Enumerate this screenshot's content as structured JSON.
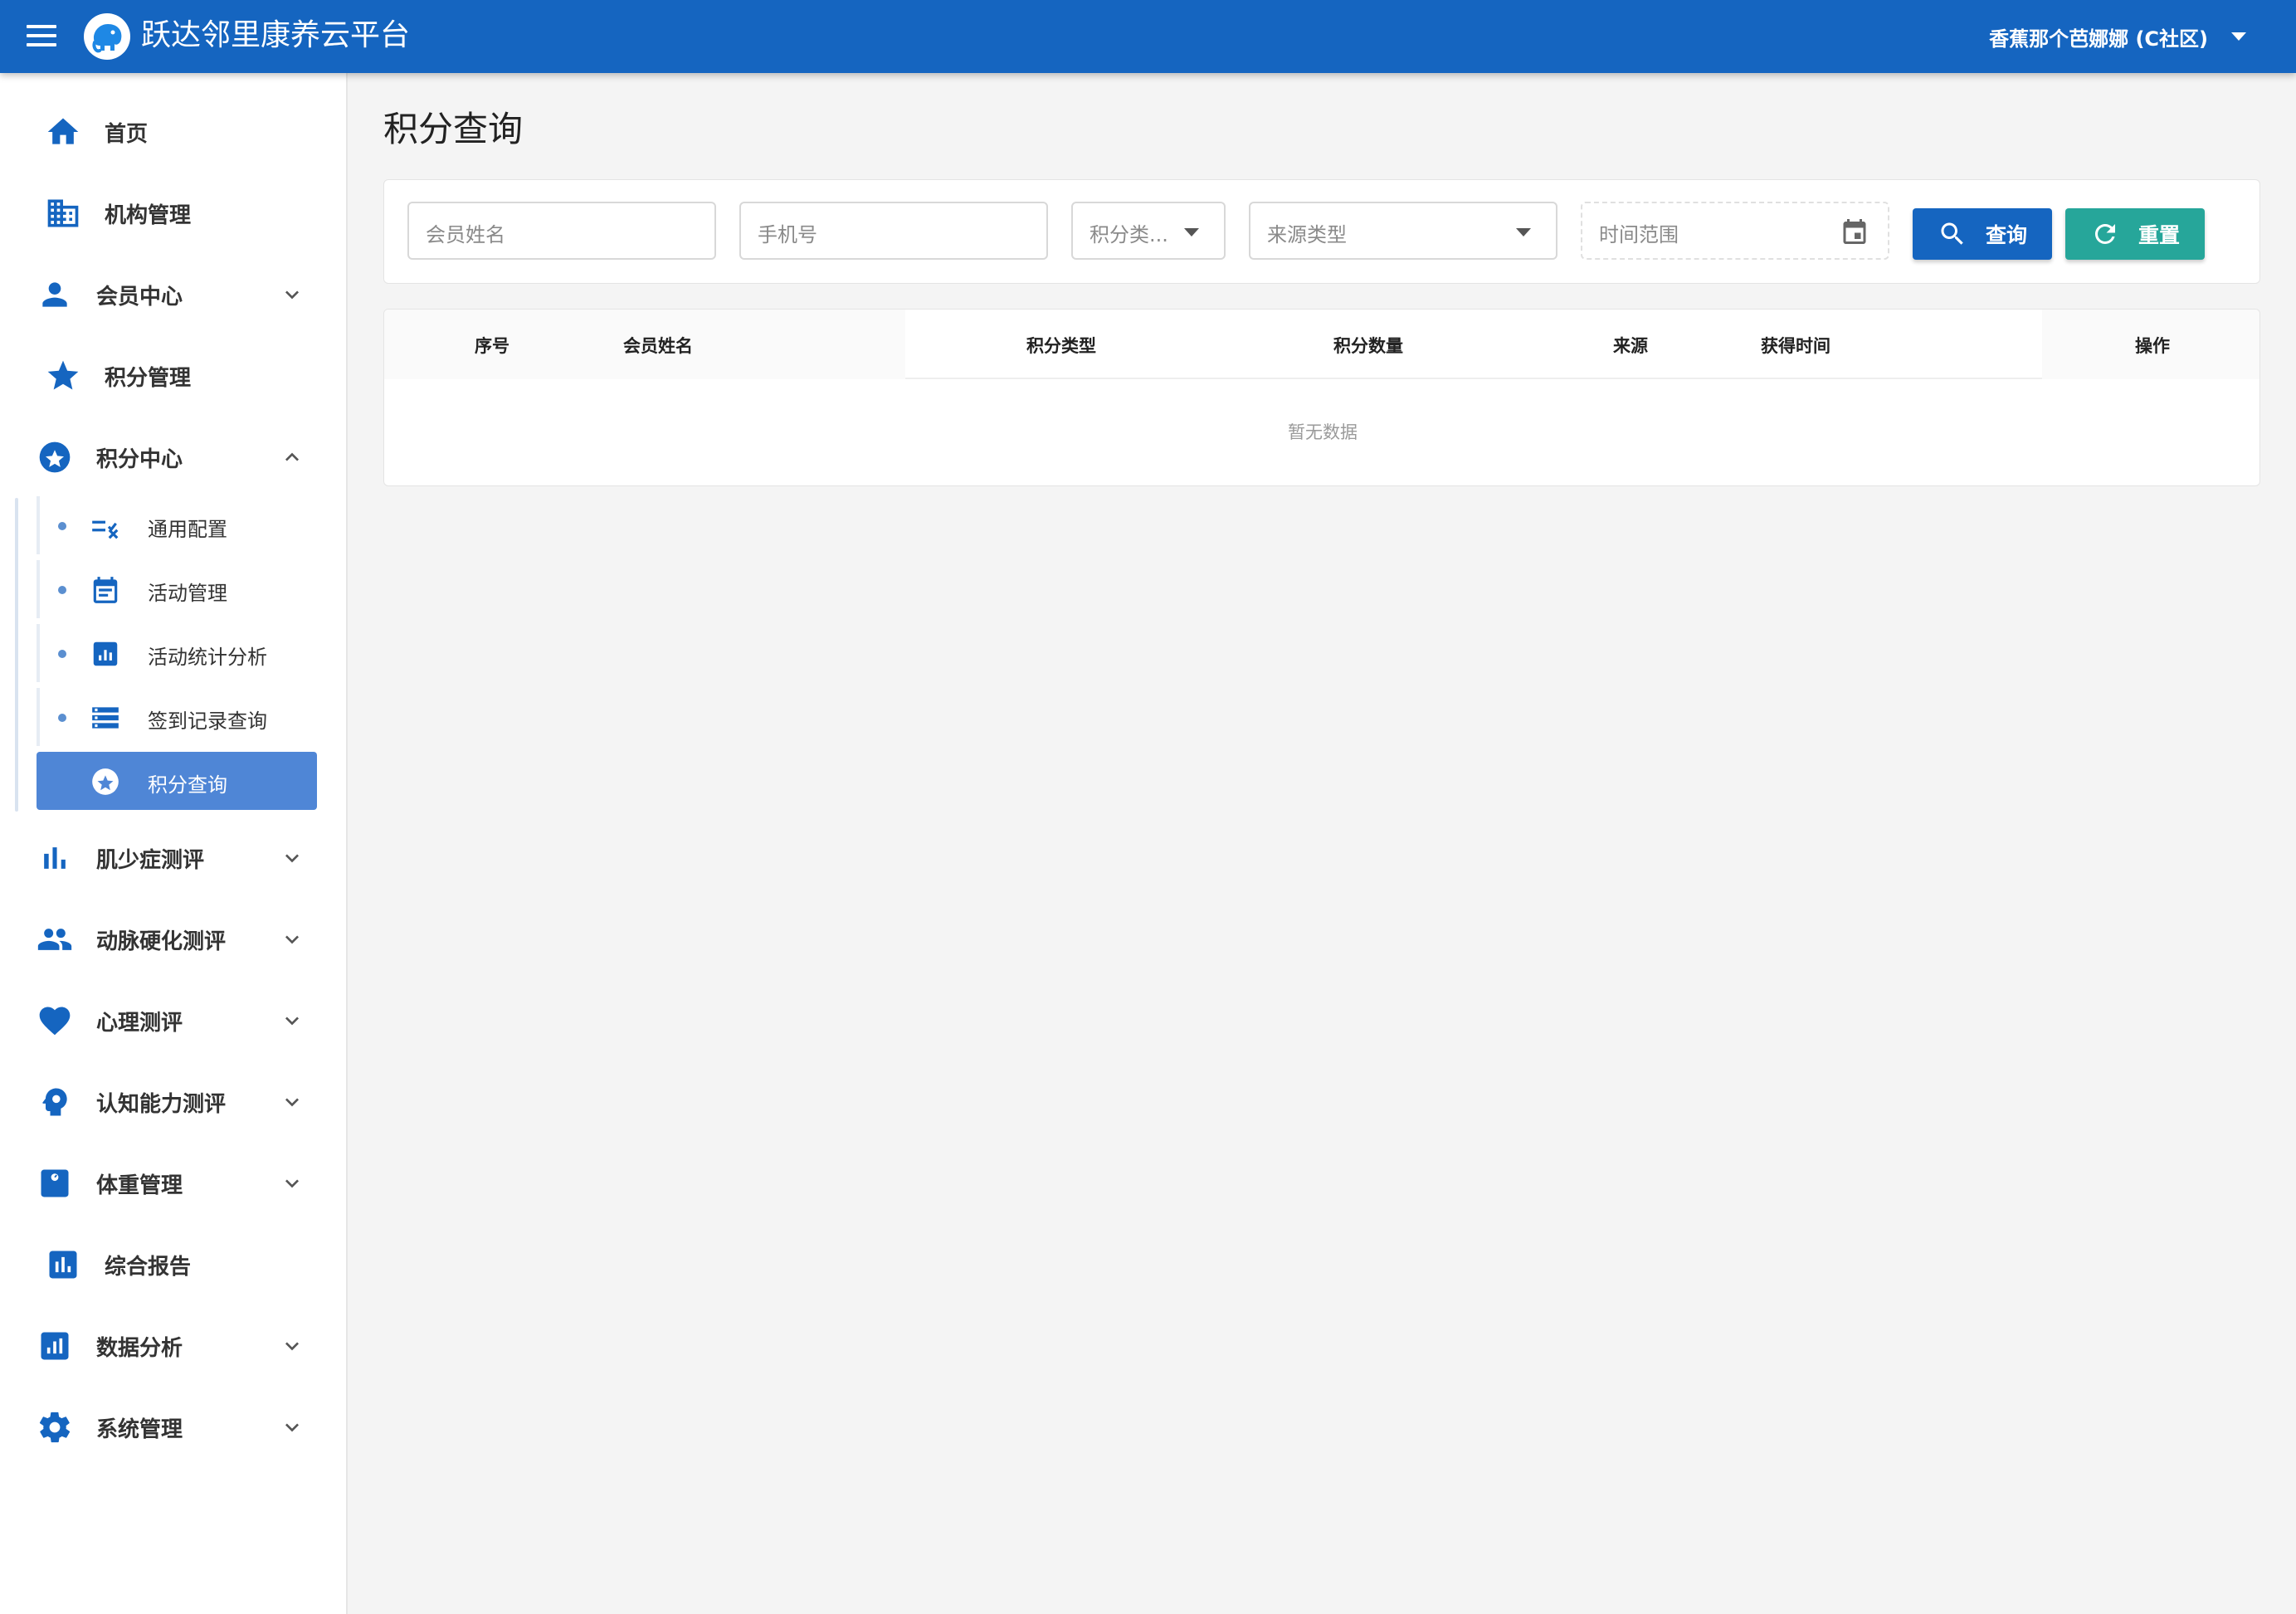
{
  "header": {
    "app_title": "跃达邻里康养云平台",
    "user_name": "香蕉那个芭娜娜 (C社区)",
    "brand_color": "#1565c0"
  },
  "sidebar": {
    "items": [
      {
        "label": "首页",
        "icon": "home-icon"
      },
      {
        "label": "机构管理",
        "icon": "building-icon"
      },
      {
        "label": "会员中心",
        "icon": "person-icon",
        "expandable": true
      },
      {
        "label": "积分管理",
        "icon": "star-icon"
      },
      {
        "label": "积分中心",
        "icon": "star-circle-icon",
        "expandable": true,
        "expanded": true
      },
      {
        "label": "肌少症测评",
        "icon": "bar-chart-icon",
        "expandable": true
      },
      {
        "label": "动脉硬化测评",
        "icon": "people-icon",
        "expandable": true
      },
      {
        "label": "心理测评",
        "icon": "heart-icon",
        "expandable": true
      },
      {
        "label": "认知能力测评",
        "icon": "brain-head-icon",
        "expandable": true
      },
      {
        "label": "体重管理",
        "icon": "scale-icon",
        "expandable": true
      },
      {
        "label": "综合报告",
        "icon": "report-chart-icon"
      },
      {
        "label": "数据分析",
        "icon": "analytics-icon",
        "expandable": true
      },
      {
        "label": "系统管理",
        "icon": "gear-icon",
        "expandable": true
      }
    ],
    "sub_items": [
      {
        "label": "通用配置",
        "icon": "rule-config-icon"
      },
      {
        "label": "活动管理",
        "icon": "calendar-icon"
      },
      {
        "label": "活动统计分析",
        "icon": "stats-icon"
      },
      {
        "label": "签到记录查询",
        "icon": "list-storage-icon"
      },
      {
        "label": "积分查询",
        "icon": "star-circle-icon",
        "active": true
      }
    ]
  },
  "main": {
    "page_title": "积分查询",
    "filters": {
      "member_name_placeholder": "会员姓名",
      "phone_placeholder": "手机号",
      "points_type_placeholder": "积分类...",
      "source_type_placeholder": "来源类型",
      "time_range_placeholder": "时间范围"
    },
    "buttons": {
      "query": "查询",
      "reset": "重置",
      "reset_color": "#26a69a"
    },
    "table": {
      "columns": [
        "序号",
        "会员姓名",
        "积分类型",
        "积分数量",
        "来源",
        "获得时间",
        "操作"
      ],
      "rows": [],
      "empty_text": "暂无数据"
    }
  }
}
